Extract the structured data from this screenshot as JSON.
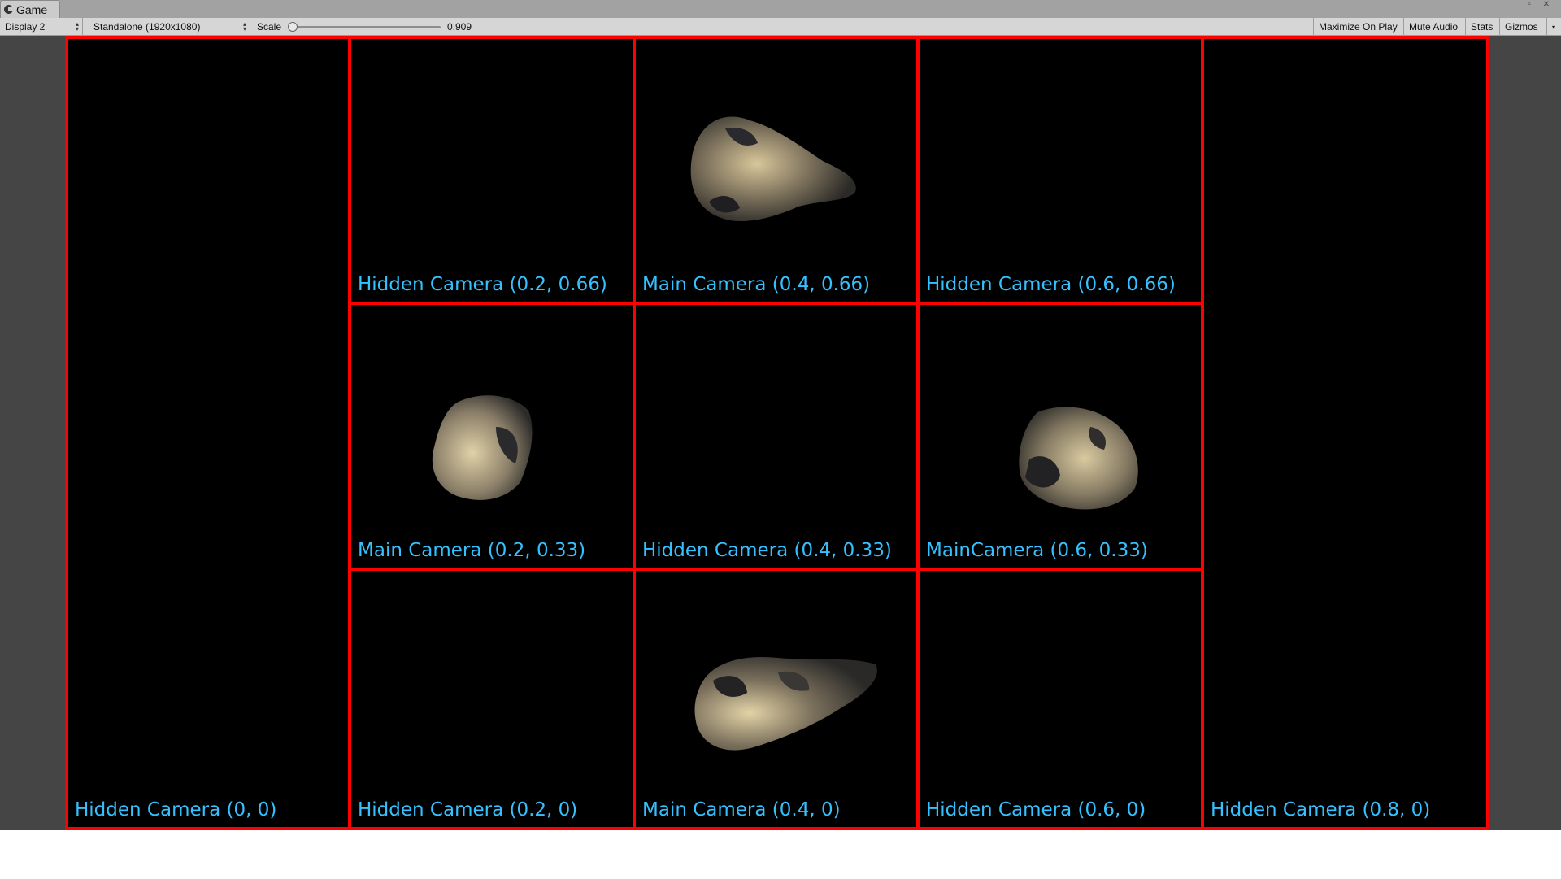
{
  "tab": {
    "title": "Game"
  },
  "toolbar": {
    "display": "Display 2",
    "resolution": "Standalone (1920x1080)",
    "scale_label": "Scale",
    "scale_value": "0.909",
    "maximize": "Maximize On Play",
    "mute": "Mute Audio",
    "stats": "Stats",
    "gizmos": "Gizmos"
  },
  "cameras": {
    "c00": "Hidden Camera (0, 0)",
    "c0266": "Hidden Camera (0.2, 0.66)",
    "c0466": "Main Camera (0.4, 0.66)",
    "c0666": "Hidden Camera (0.6, 0.66)",
    "c0233": "Main Camera (0.2, 0.33)",
    "c0433": "Hidden Camera (0.4, 0.33)",
    "c0633": "MainCamera (0.6, 0.33)",
    "c020": "Hidden Camera (0.2, 0)",
    "c040": "Main Camera (0.4, 0)",
    "c060": "Hidden Camera (0.6, 0)",
    "c080": "Hidden Camera (0.8, 0)"
  },
  "colors": {
    "border": "#ff0000",
    "label": "#35c1ff"
  }
}
